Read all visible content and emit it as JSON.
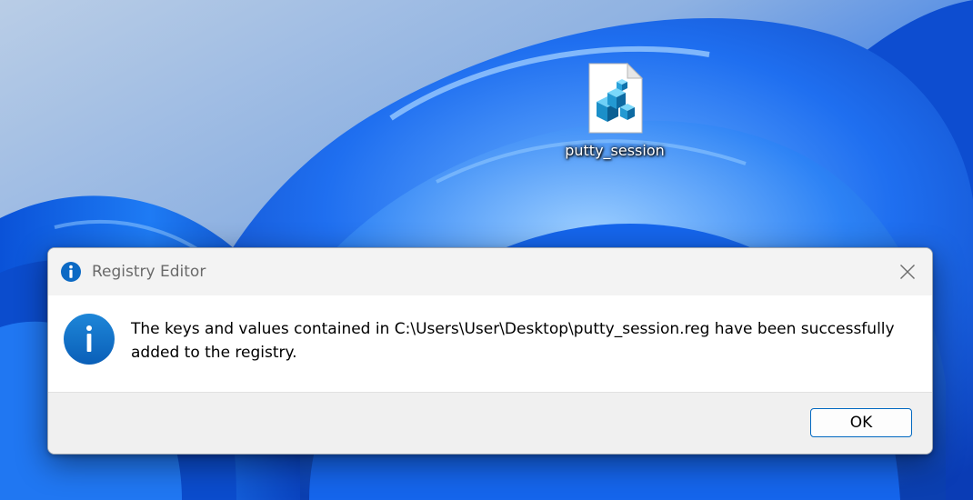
{
  "desktop": {
    "icon": {
      "label": "putty_session",
      "icon_name": "registry-file-icon"
    }
  },
  "dialog": {
    "title": "Registry Editor",
    "title_icon": "info-icon",
    "message_icon": "info-icon",
    "message": "The keys and values contained in C:\\Users\\User\\Desktop\\putty_session.reg have been successfully added to the registry.",
    "ok_label": "OK",
    "close_icon": "close-icon"
  },
  "colors": {
    "info_blue": "#0b69c4",
    "accent": "#0067c0",
    "wallpaper_blue": "#1a5fd6"
  }
}
